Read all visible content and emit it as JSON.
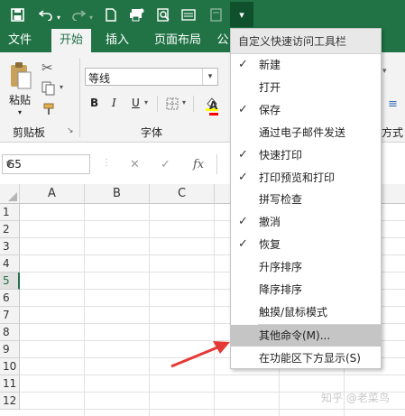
{
  "toolbar": {
    "icons": [
      "save-icon",
      "undo-icon",
      "redo-icon",
      "new-doc-icon",
      "quick-print-icon",
      "print-preview-icon",
      "form-icon",
      "calculator-icon"
    ],
    "more_glyph": "▾"
  },
  "tabs": [
    "文件",
    "开始",
    "插入",
    "页面布局",
    "公"
  ],
  "ribbon": {
    "paste_label": "粘贴",
    "clipboard_label": "剪贴板",
    "font_name": "等线",
    "font_group_label": "字体",
    "right_group_label": "方式",
    "bold": "B",
    "italic": "I",
    "underline": "U",
    "font_color_letter": "A",
    "font_color": "#ff0000",
    "fill_color": "#ffff00"
  },
  "formula_bar": {
    "name_box": "G5",
    "fx": "fx"
  },
  "grid": {
    "columns": [
      "A",
      "B",
      "C"
    ],
    "rows": [
      "1",
      "2",
      "3",
      "4",
      "5",
      "6",
      "7",
      "8",
      "9",
      "10",
      "11",
      "12"
    ],
    "active_row": "5"
  },
  "menu": {
    "title": "自定义快速访问工具栏",
    "items": [
      {
        "label": "新建",
        "checked": true
      },
      {
        "label": "打开",
        "checked": false
      },
      {
        "label": "保存",
        "checked": true
      },
      {
        "label": "通过电子邮件发送",
        "checked": false
      },
      {
        "label": "快速打印",
        "checked": true
      },
      {
        "label": "打印预览和打印",
        "checked": true
      },
      {
        "label": "拼写检查",
        "checked": false
      },
      {
        "label": "撤消",
        "checked": true
      },
      {
        "label": "恢复",
        "checked": true
      },
      {
        "label": "升序排序",
        "checked": false
      },
      {
        "label": "降序排序",
        "checked": false
      },
      {
        "label": "触摸/鼠标模式",
        "checked": false
      },
      {
        "label": "其他命令(M)...",
        "checked": false,
        "highlighted": true
      },
      {
        "label": "在功能区下方显示(S)",
        "checked": false
      }
    ],
    "check_glyph": "✓"
  },
  "colors": {
    "excel_green": "#217346",
    "arrow": "#e53935",
    "highlight": "#c5c5c5"
  },
  "watermark": "知乎 @老菜鸟"
}
